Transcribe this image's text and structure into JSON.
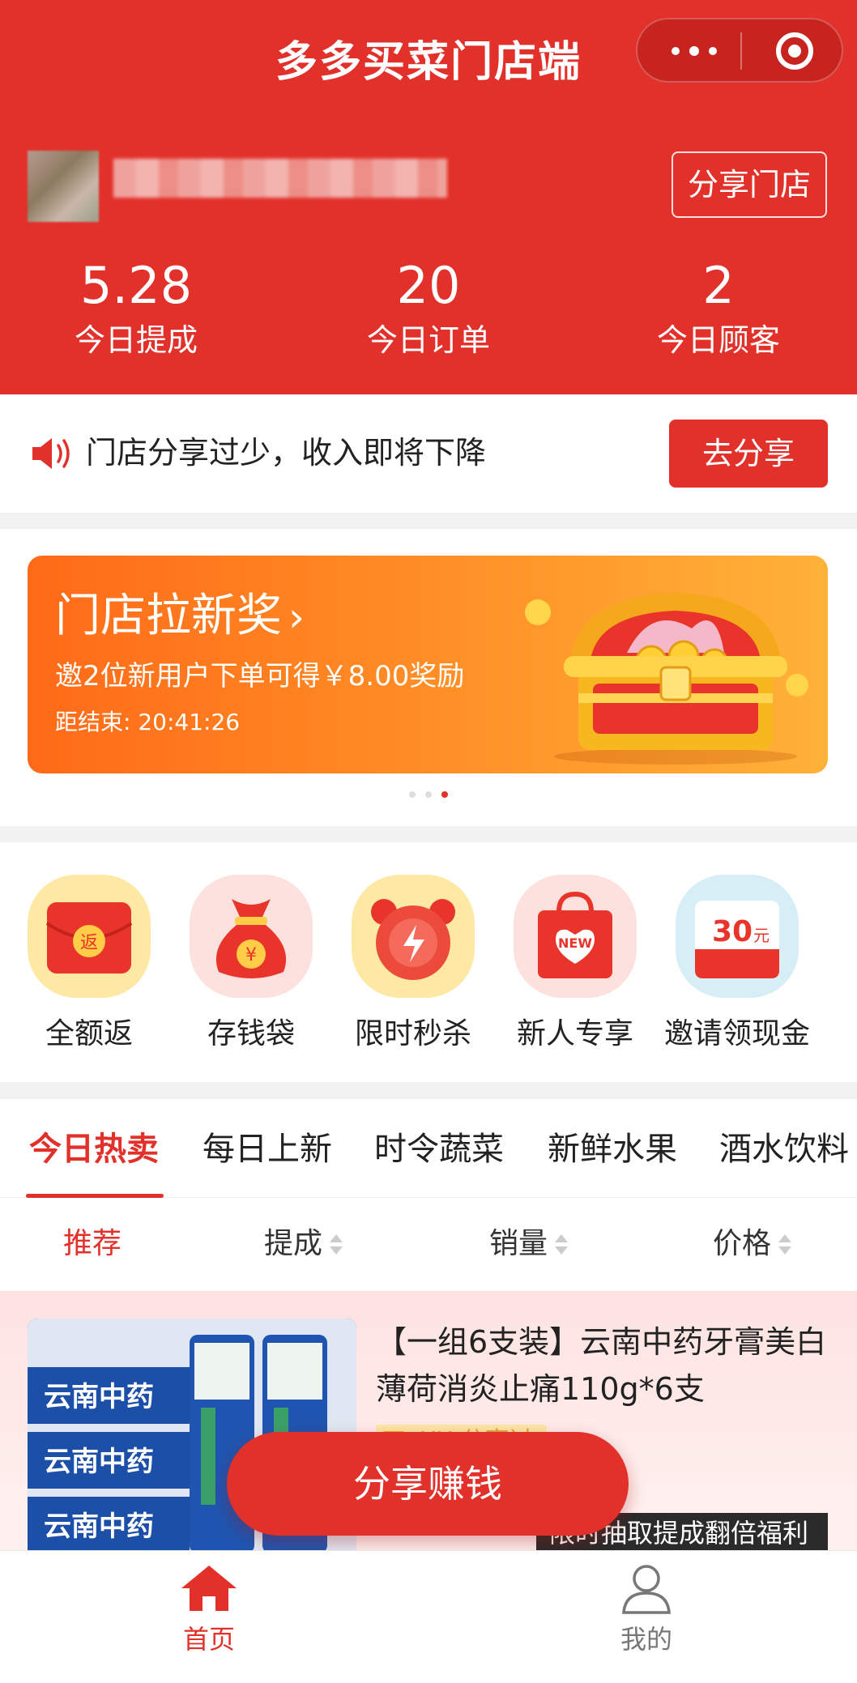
{
  "header": {
    "title": "多多买菜门店端",
    "share_store_label": "分享门店"
  },
  "stats": [
    {
      "value": "5.28",
      "label": "今日提成"
    },
    {
      "value": "20",
      "label": "今日订单"
    },
    {
      "value": "2",
      "label": "今日顾客"
    }
  ],
  "notice": {
    "text": "门店分享过少，收入即将下降",
    "button_label": "去分享"
  },
  "banner": {
    "title": "门店拉新奖",
    "subtitle": "邀2位新用户下单可得￥8.00奖励",
    "countdown": "距结束: 20:41:26",
    "active_dot": 3,
    "dot_count": 3
  },
  "shortcuts": [
    {
      "label": "全额返",
      "icon": "red-envelope-icon",
      "badge": "返"
    },
    {
      "label": "存钱袋",
      "icon": "money-bag-icon",
      "badge": "¥"
    },
    {
      "label": "限时秒杀",
      "icon": "alarm-clock-icon"
    },
    {
      "label": "新人专享",
      "icon": "shopping-bag-icon",
      "badge": "NEW"
    },
    {
      "label": "邀请领现金",
      "icon": "cash-coupon-icon",
      "badge_num": "30",
      "badge_unit": "元"
    }
  ],
  "tabs": [
    "今日热卖",
    "每日上新",
    "时令蔬菜",
    "新鲜水果",
    "酒水饮料"
  ],
  "sort": {
    "recommend": "推荐",
    "commission": "提成",
    "sales": "销量",
    "price": "价格"
  },
  "product": {
    "title": "【一组6支装】云南中药牙膏美白薄荷消炎止痛110g*6支",
    "tag": "XX 分享过",
    "promo": "限时抽取提成翻倍福利",
    "image_text": "云南中药"
  },
  "share_earn_label": "分享赚钱",
  "bottom_nav": {
    "home": "首页",
    "mine": "我的"
  },
  "colors": {
    "brand_red": "#e2302a",
    "banner_orange": "#ff7a1e"
  }
}
